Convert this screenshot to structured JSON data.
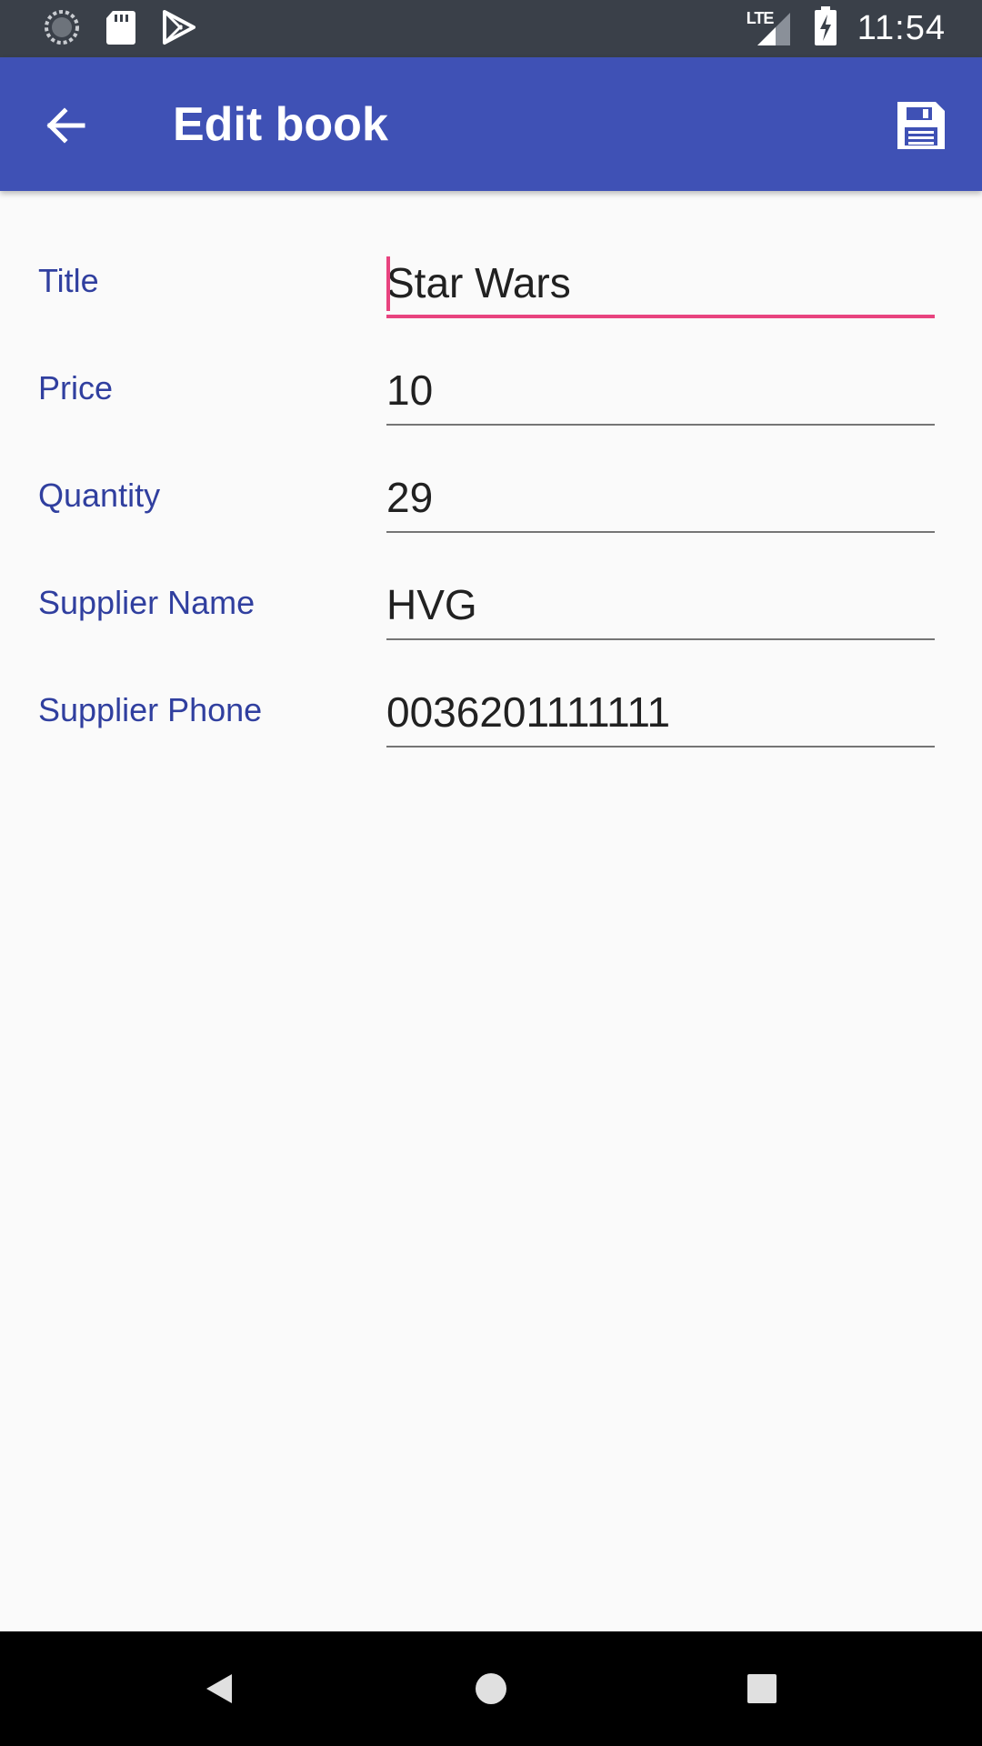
{
  "status_bar": {
    "time": "11:54",
    "network_label": "LTE",
    "left_icons": [
      "loading-circle-icon",
      "sd-card-icon",
      "play-store-icon"
    ],
    "right_icons": [
      "signal-icon",
      "battery-charging-icon"
    ]
  },
  "app_bar": {
    "title": "Edit book",
    "back_icon": "arrow-back-icon",
    "save_icon": "save-icon",
    "color": "#3f51b5"
  },
  "form": {
    "fields": [
      {
        "label": "Title",
        "value": "Star Wars",
        "focused": true
      },
      {
        "label": "Price",
        "value": "10",
        "focused": false
      },
      {
        "label": "Quantity",
        "value": "29",
        "focused": false
      },
      {
        "label": "Supplier Name",
        "value": "HVG",
        "focused": false
      },
      {
        "label": "Supplier Phone",
        "value": "0036201111111",
        "focused": false
      }
    ],
    "label_color": "#303f9f",
    "focus_color": "#e8437f"
  },
  "nav_bar": {
    "buttons": [
      "back-triangle-icon",
      "home-circle-icon",
      "recents-square-icon"
    ]
  }
}
